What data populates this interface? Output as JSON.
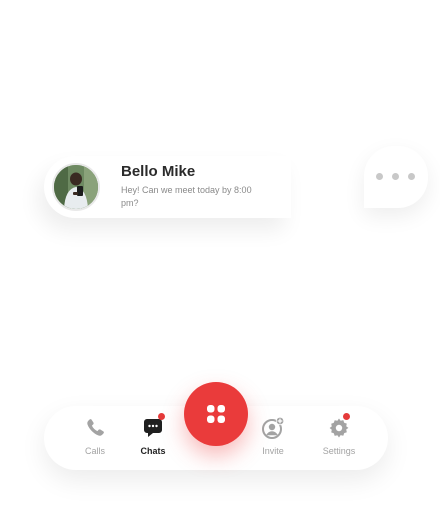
{
  "message_card": {
    "contact_name": "Bello Mike",
    "message_preview": "Hey! Can we meet today by 8:00 pm?",
    "avatar_icon": "user-avatar-photo"
  },
  "typing_indicator": {
    "icon": "typing-dots-icon"
  },
  "bottom_nav": {
    "items": [
      {
        "label": "Calls",
        "icon": "phone-icon",
        "active": false,
        "badge": false
      },
      {
        "label": "Chats",
        "icon": "chat-bubble-icon",
        "active": true,
        "badge": true
      },
      {
        "label": "Invite",
        "icon": "add-user-icon",
        "active": false,
        "badge": false
      },
      {
        "label": "Settings",
        "icon": "gear-icon",
        "active": false,
        "badge": true
      }
    ],
    "center_button_icon": "grid-apps-icon"
  },
  "colors": {
    "accent": "#ea3b3b",
    "badge": "#e53a3a",
    "active_text": "#1f1f1f",
    "inactive": "#a3a3a3"
  }
}
